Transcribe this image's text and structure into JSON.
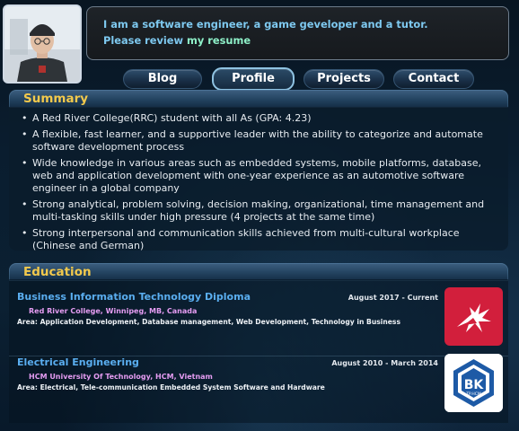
{
  "header": {
    "intro_line1": "I am a software engineer, a game geveloper and a tutor.",
    "intro_line2_prefix": "Please review ",
    "resume_link": "my resume"
  },
  "nav": {
    "items": [
      {
        "label": "Blog"
      },
      {
        "label": "Profile"
      },
      {
        "label": "Projects"
      },
      {
        "label": "Contact"
      }
    ],
    "active": "Profile"
  },
  "summary": {
    "title": "Summary",
    "items": [
      "A Red River College(RRC) student with all As (GPA: 4.23)",
      "A flexible, fast learner, and a supportive leader with the ability to categorize and automate software development process",
      "Wide knowledge in various areas such as embedded systems, mobile platforms, database, web and application development with one-year experience as an automotive software engineer in a global company",
      "Strong analytical, problem solving, decision making, organizational, time management and multi-tasking skills under high pressure (4 projects at the same time)",
      "Strong interpersonal and communication skills achieved from multi-cultural workplace (Chinese and German)"
    ]
  },
  "education": {
    "title": "Education",
    "items": [
      {
        "title": "Business Information Technology Diploma",
        "date": "August 2017 - Current",
        "school": "Red River College, Winnipeg, MB, Canada",
        "area": "Area: Application Development, Database management, Web Development, Technology in Business",
        "logo_icon": "red-river-college-logo"
      },
      {
        "title": "Electrical Engineering",
        "date": "August 2010 - March 2014",
        "school": "HCM University Of Technology, HCM, Vietnam",
        "area": "Area: Electrical, Tele-communication Embedded System Software and Hardware",
        "logo_icon": "bk-hcmut-logo",
        "logo_text": "BK",
        "logo_subtext": "TP.HCM"
      }
    ]
  },
  "colors": {
    "accent_gold": "#f2c94c",
    "link_blue": "#5aaef0",
    "school_pink": "#e59cf2",
    "intro_blue": "#7ec9f0",
    "resume_green": "#8ef0c8"
  }
}
